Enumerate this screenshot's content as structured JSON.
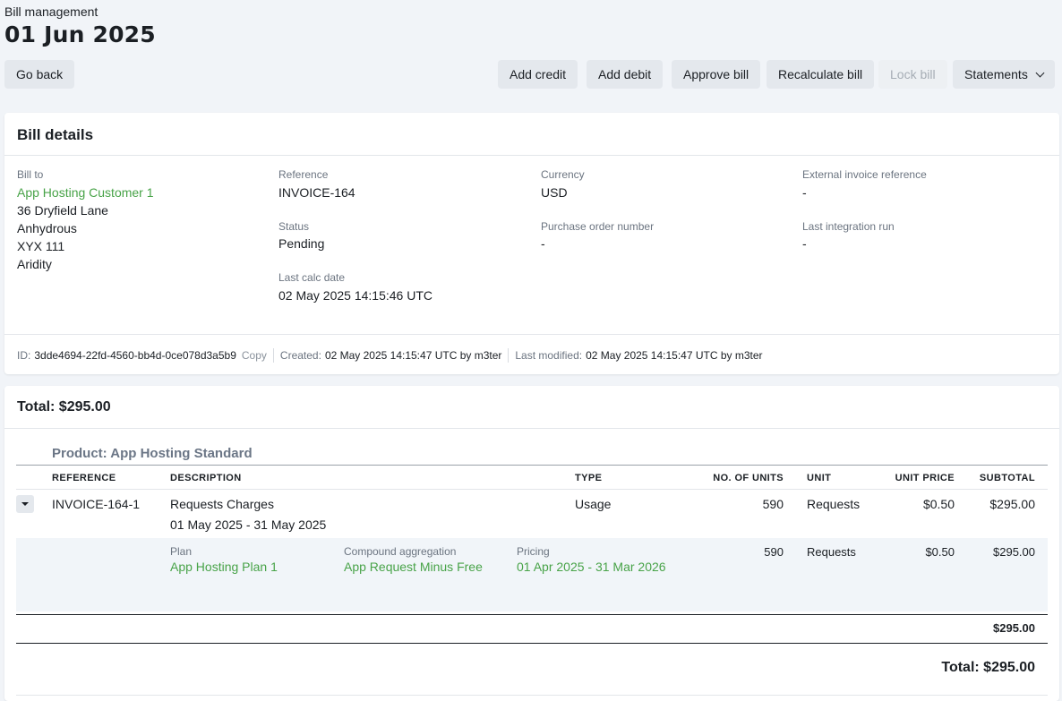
{
  "header": {
    "breadcrumb": "Bill management",
    "title": "01 Jun 2025"
  },
  "toolbar": {
    "go_back": "Go back",
    "add_credit": "Add credit",
    "add_debit": "Add debit",
    "approve_bill": "Approve bill",
    "recalculate_bill": "Recalculate bill",
    "lock_bill": "Lock bill",
    "statements": "Statements"
  },
  "details": {
    "title": "Bill details",
    "bill_to_label": "Bill to",
    "customer": "App Hosting Customer 1",
    "address": [
      "36 Dryfield Lane",
      "Anhydrous",
      "XYX 111",
      "Aridity"
    ],
    "reference_label": "Reference",
    "reference": "INVOICE-164",
    "status_label": "Status",
    "status": "Pending",
    "last_calc_label": "Last calc date",
    "last_calc": "02 May 2025 14:15:46 UTC",
    "currency_label": "Currency",
    "currency": "USD",
    "po_label": "Purchase order number",
    "po": "-",
    "ext_ref_label": "External invoice reference",
    "ext_ref": "-",
    "last_integration_label": "Last integration run",
    "last_integration": "-"
  },
  "meta": {
    "id_label": "ID:",
    "id": "3dde4694-22fd-4560-bb4d-0ce078d3a5b9",
    "copy": "Copy",
    "created_label": "Created:",
    "created": "02 May 2025 14:15:47 UTC by m3ter",
    "modified_label": "Last modified:",
    "modified": "02 May 2025 14:15:47 UTC by m3ter"
  },
  "totals_card": {
    "title": "Total: $295.00",
    "product": "Product: App Hosting Standard",
    "columns": {
      "reference": "REFERENCE",
      "description": "DESCRIPTION",
      "type": "TYPE",
      "units": "NO. OF UNITS",
      "unit": "UNIT",
      "unit_price": "UNIT PRICE",
      "subtotal": "SUBTOTAL"
    },
    "row": {
      "reference": "INVOICE-164-1",
      "description": "Requests Charges",
      "period": "01 May 2025 - 31 May 2025",
      "type": "Usage",
      "units": "590",
      "unit": "Requests",
      "unit_price": "$0.50",
      "subtotal": "$295.00"
    },
    "sub": {
      "plan_label": "Plan",
      "plan": "App Hosting Plan 1",
      "agg_label": "Compound aggregation",
      "agg": "App Request Minus Free",
      "pricing_label": "Pricing",
      "pricing": "01 Apr 2025 - 31 Mar 2026",
      "units": "590",
      "unit": "Requests",
      "unit_price": "$0.50",
      "subtotal": "$295.00"
    },
    "section_total": "$295.00",
    "grand_total": "Total: $295.00"
  }
}
